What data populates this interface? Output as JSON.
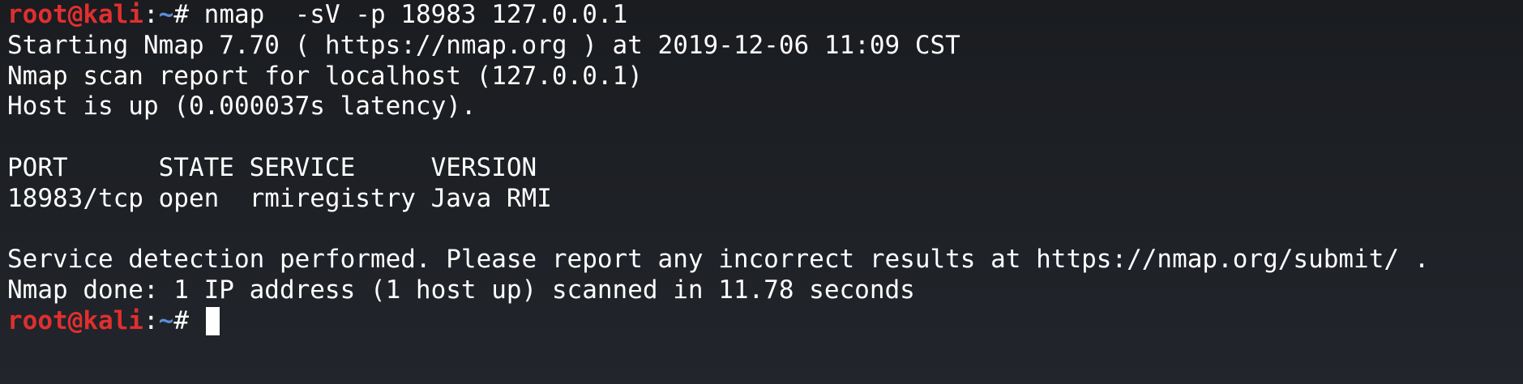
{
  "terminal": {
    "prompt": {
      "user_host": "root@kali",
      "separator": ":",
      "path": "~",
      "symbol": "# "
    },
    "command": "nmap  -sV -p 18983 127.0.0.1",
    "output": [
      "Starting Nmap 7.70 ( https://nmap.org ) at 2019-12-06 11:09 CST",
      "Nmap scan report for localhost (127.0.0.1)",
      "Host is up (0.000037s latency).",
      "",
      "PORT      STATE SERVICE     VERSION",
      "18983/tcp open  rmiregistry Java RMI",
      "",
      "Service detection performed. Please report any incorrect results at https://nmap.org/submit/ .",
      "Nmap done: 1 IP address (1 host up) scanned in 11.78 seconds"
    ],
    "colors": {
      "background": "#1d1f24",
      "text": "#ffffff",
      "prompt_user": "#e02f2f",
      "prompt_path": "#5a8dd6"
    }
  }
}
